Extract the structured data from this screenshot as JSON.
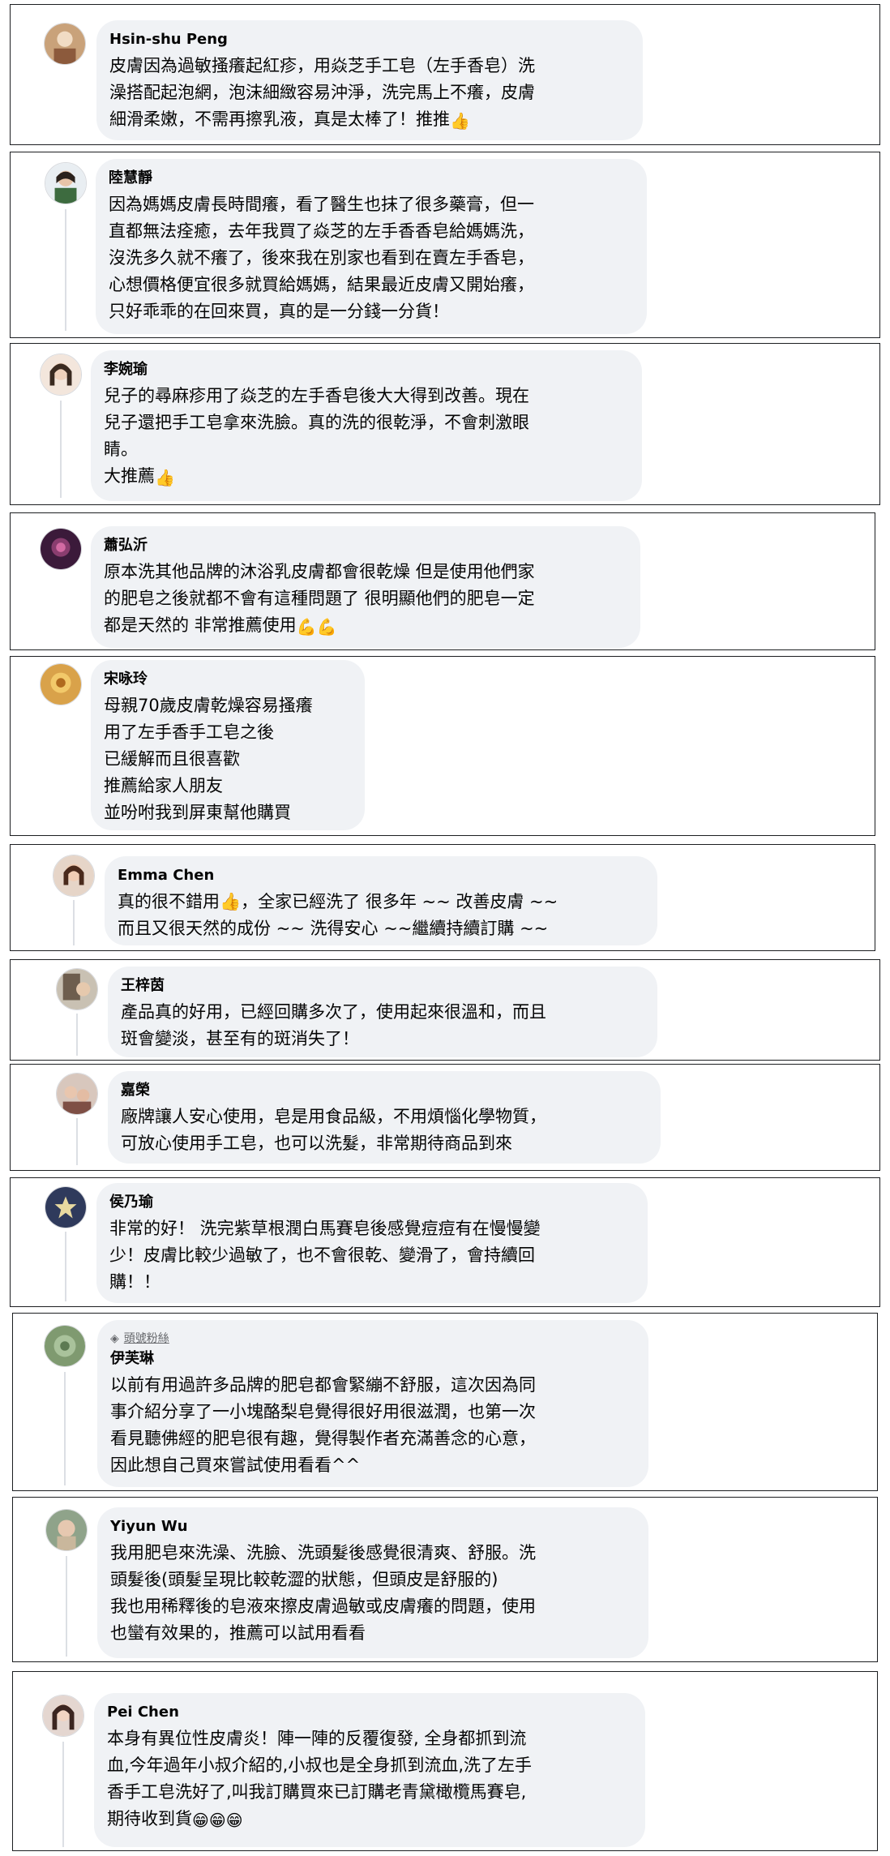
{
  "comments": [
    {
      "author": "Hsin-shu Peng",
      "lines": [
        "皮膚因為過敏搔癢起紅疹，用焱芝手工皂（左手香皂）洗",
        "澡搭配起泡網，泡沫細緻容易沖淨，洗完馬上不癢，皮膚",
        "細滑柔嫩，不需再擦乳液，真是太棒了！推推"
      ],
      "emoji": "👍",
      "avatar_color": "#c9a27a"
    },
    {
      "author": "陸慧靜",
      "lines": [
        "因為媽媽皮膚長時間癢，看了醫生也抹了很多藥膏，但一",
        "直都無法痊癒，去年我買了焱芝的左手香香皂給媽媽洗，",
        "沒洗多久就不癢了，後來我在別家也看到在賣左手香皂，",
        "心想價格便宜很多就買給媽媽，結果最近皮膚又開始癢，",
        "只好乖乖的在回來買，真的是一分錢一分貨！"
      ],
      "avatar_color": "#6b8fa8"
    },
    {
      "author": "李婉瑜",
      "lines": [
        "兒子的尋麻疹用了焱芝的左手香皂後大大得到改善。現在",
        "兒子還把手工皂拿來洗臉。真的洗的很乾淨，不會刺激眼",
        "睛。",
        "大推薦"
      ],
      "emoji": "👍",
      "avatar_color": "#d7b59a"
    },
    {
      "author": "蕭弘沂",
      "lines": [
        "原本洗其他品牌的沐浴乳皮膚都會很乾燥 但是使用他們家",
        "的肥皂之後就都不會有這種問題了 很明顯他們的肥皂一定",
        "都是天然的 非常推薦使用"
      ],
      "emoji": "💪💪",
      "avatar_color": "#5b2d4e"
    },
    {
      "author": "宋咏玲",
      "lines": [
        "母親70歲皮膚乾燥容易搔癢",
        "用了左手香手工皂之後",
        "已緩解而且很喜歡",
        "推薦給家人朋友",
        "並吩咐我到屏東幫他購買"
      ],
      "avatar_color": "#d9a24a"
    },
    {
      "author": "Emma Chen",
      "lines": [
        "真的很不錯用👍，全家已經洗了 很多年 ~~ 改善皮膚 ~~",
        "而且又很天然的成份 ~~ 洗得安心 ~~繼續持續訂購 ~~"
      ],
      "avatar_color": "#c7826a"
    },
    {
      "author": "王梓茵",
      "lines": [
        "產品真的好用，已經回購多次了，使用起來很溫和，而且",
        "斑會變淡，甚至有的斑消失了！"
      ],
      "avatar_color": "#8a7f6e"
    },
    {
      "author": "嘉榮",
      "lines": [
        "廠牌讓人安心使用，皂是用食品級，不用煩惱化學物質，",
        "可放心使用手工皂，也可以洗髮，非常期待商品到來"
      ],
      "avatar_color": "#a0786a"
    },
    {
      "author": "侯乃瑜",
      "lines": [
        "非常的好！ 洗完紫草根潤白馬賽皂後感覺痘痘有在慢慢變",
        "少！皮膚比較少過敏了，也不會很乾、變滑了，會持續回",
        "購！！"
      ],
      "avatar_color": "#2f3a5c"
    },
    {
      "author": "伊芙琳",
      "badge": "頭號粉絲",
      "lines": [
        "以前有用過許多品牌的肥皂都會緊繃不舒服，這次因為同",
        "事介紹分享了一小塊酪梨皂覺得很好用很滋潤，也第一次",
        "看見聽佛經的肥皂很有趣，覺得製作者充滿善念的心意，",
        "因此想自己買來嘗試使用看看^^"
      ],
      "avatar_color": "#7f9a70"
    },
    {
      "author": "Yiyun Wu",
      "lines": [
        "我用肥皂來洗澡、洗臉、洗頭髮後感覺很清爽、舒服。洗",
        "頭髮後(頭髮呈現比較乾澀的狀態，但頭皮是舒服的)",
        "我也用稀釋後的皂液來擦皮膚過敏或皮膚癢的問題，使用",
        "也蠻有效果的，推薦可以試用看看"
      ],
      "avatar_color": "#8fa38a"
    },
    {
      "author": "Pei Chen",
      "lines": [
        "本身有異位性皮膚炎！陣一陣的反覆復發, 全身都抓到流",
        "血,今年過年小叔介紹的,小叔也是全身抓到流血,洗了左手",
        "香手工皂洗好了,叫我訂購買來已訂購老青黛橄欖馬賽皂,",
        "期待收到貨"
      ],
      "emoji": "😁😁😁",
      "avatar_color": "#b58c7c"
    }
  ]
}
